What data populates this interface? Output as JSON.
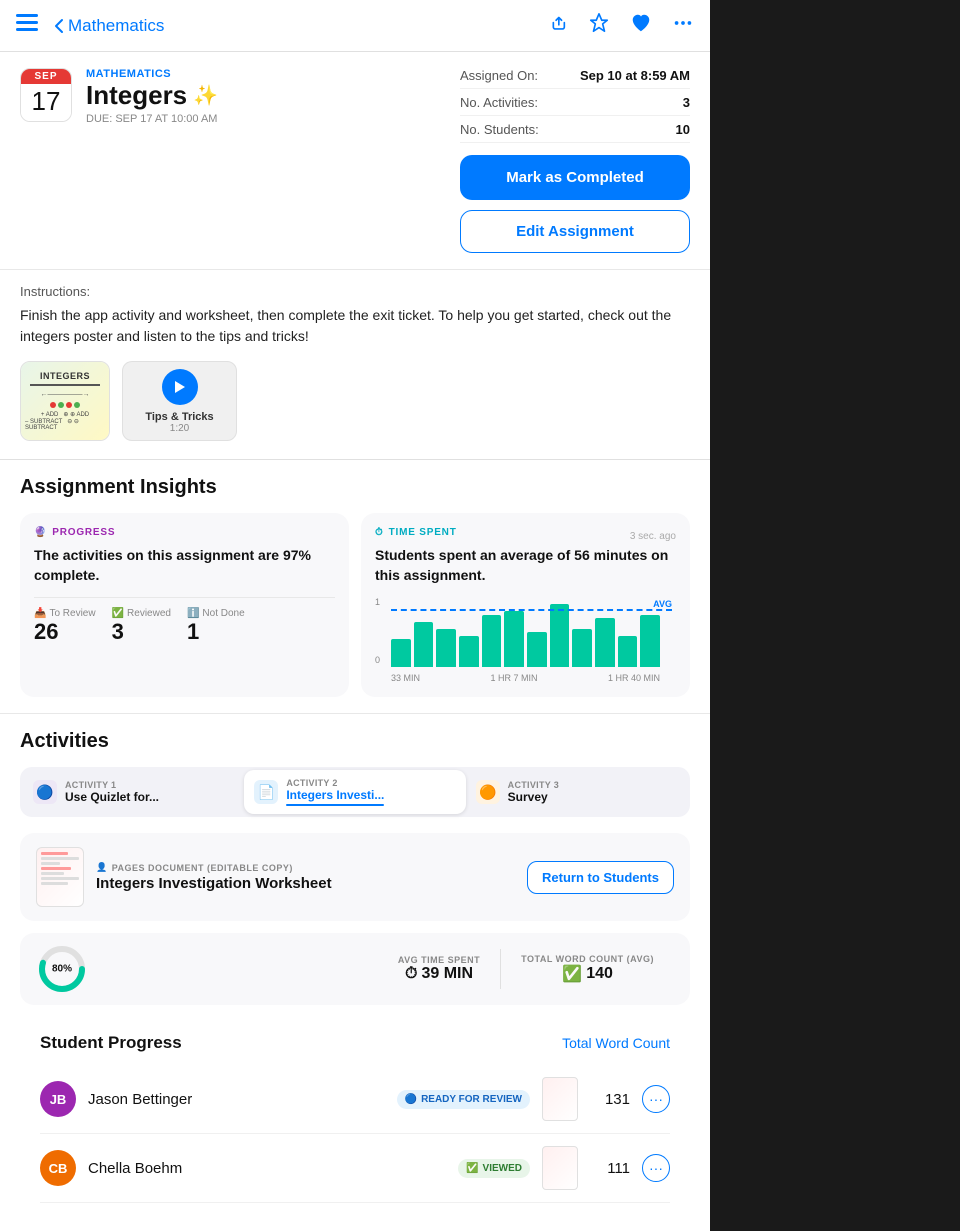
{
  "nav": {
    "back_label": "Mathematics",
    "icons": [
      "share-icon",
      "pin-icon",
      "heart-icon",
      "more-icon"
    ]
  },
  "header": {
    "subject": "MATHEMATICS",
    "title": "Integers",
    "sparkle": "✨",
    "due_date": "DUE: SEP 17 AT 10:00 AM",
    "cal_month": "SEP",
    "cal_day": "17",
    "assigned_on_label": "Assigned On:",
    "assigned_on_value": "Sep 10 at 8:59 AM",
    "activities_label": "No. Activities:",
    "activities_value": "3",
    "students_label": "No. Students:",
    "students_value": "10",
    "btn_mark_complete": "Mark as Completed",
    "btn_edit_assignment": "Edit Assignment"
  },
  "instructions": {
    "label": "Instructions:",
    "text": "Finish the app activity and worksheet, then complete the exit ticket. To help you get started, check out the integers poster and listen to the tips and tricks!"
  },
  "attachments": [
    {
      "type": "image",
      "name": "Integers Poster"
    },
    {
      "type": "video",
      "name": "Tips & Tricks",
      "duration": "1:20"
    }
  ],
  "insights": {
    "title": "Assignment Insights",
    "progress_card": {
      "label": "PROGRESS",
      "main_text": "The activities on this assignment are 97% complete.",
      "to_review_label": "To Review",
      "to_review_value": "26",
      "reviewed_label": "Reviewed",
      "reviewed_value": "3",
      "not_done_label": "Not Done",
      "not_done_value": "1"
    },
    "time_card": {
      "label": "TIME SPENT",
      "time_ago": "3 sec. ago",
      "main_text": "Students spent an average of 56 minutes on this assignment.",
      "bars": [
        40,
        60,
        55,
        45,
        70,
        75,
        50,
        80,
        55,
        65,
        45,
        70
      ],
      "avg_pct": 62,
      "x_labels": [
        "33 MIN",
        "1 HR 7 MIN",
        "1 HR 40 MIN"
      ],
      "y_labels": [
        "1",
        "0"
      ]
    }
  },
  "activities": {
    "title": "Activities",
    "tabs": [
      {
        "number": "ACTIVITY 1",
        "name": "Use Quizlet for...",
        "icon": "🟣",
        "color": "#7c3aed",
        "active": false
      },
      {
        "number": "ACTIVITY 2",
        "name": "Integers Investi...",
        "icon": "📄",
        "color": "#1565c0",
        "active": true
      },
      {
        "number": "ACTIVITY 3",
        "name": "Survey",
        "icon": "🟠",
        "color": "#ef6c00",
        "active": false
      }
    ],
    "document": {
      "type_label": "PAGES DOCUMENT (EDITABLE COPY)",
      "name": "Integers Investigation Worksheet",
      "btn_return": "Return to Students"
    },
    "stats": {
      "donut_pct": "80%",
      "avg_time_label": "AVG TIME SPENT",
      "avg_time_value": "39 MIN",
      "word_count_label": "TOTAL WORD COUNT (AVG)",
      "word_count_value": "140"
    }
  },
  "student_progress": {
    "title": "Student Progress",
    "total_word_count_link": "Total Word Count",
    "students": [
      {
        "initials": "JB",
        "name": "Jason Bettinger",
        "status": "READY FOR REVIEW",
        "status_type": "review",
        "word_count": "131",
        "avatar_color": "#9c27b0"
      },
      {
        "initials": "CB",
        "name": "Chella Boehm",
        "status": "VIEWED",
        "status_type": "viewed",
        "word_count": "111",
        "avatar_color": "#ef6c00"
      }
    ]
  }
}
